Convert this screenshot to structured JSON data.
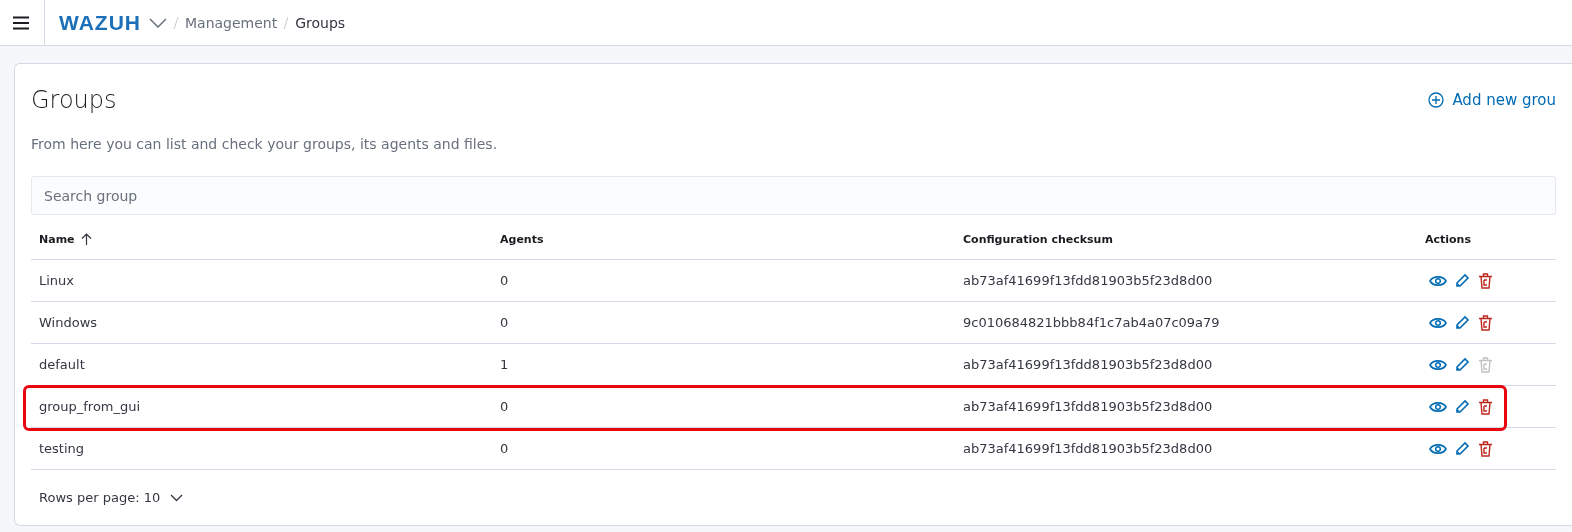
{
  "breadcrumbs": [
    {
      "label": "Management",
      "current": false
    },
    {
      "label": "Groups",
      "current": true
    }
  ],
  "logo": "WAZUH",
  "page": {
    "title": "Groups",
    "description": "From here you can list and check your groups, its agents and files.",
    "add_button": "Add new grou"
  },
  "search": {
    "placeholder": "Search group"
  },
  "table": {
    "columns": [
      {
        "label": "Name",
        "sorted": true
      },
      {
        "label": "Agents",
        "sorted": false
      },
      {
        "label": "Configuration checksum",
        "sorted": false
      },
      {
        "label": "Actions",
        "sorted": false
      }
    ],
    "rows": [
      {
        "name": "Linux",
        "agents": "0",
        "checksum": "ab73af41699f13fdd81903b5f23d8d00",
        "delete_disabled": false,
        "highlighted": false
      },
      {
        "name": "Windows",
        "agents": "0",
        "checksum": "9c010684821bbb84f1c7ab4a07c09a79",
        "delete_disabled": false,
        "highlighted": false
      },
      {
        "name": "default",
        "agents": "1",
        "checksum": "ab73af41699f13fdd81903b5f23d8d00",
        "delete_disabled": true,
        "highlighted": false
      },
      {
        "name": "group_from_gui",
        "agents": "0",
        "checksum": "ab73af41699f13fdd81903b5f23d8d00",
        "delete_disabled": false,
        "highlighted": true
      },
      {
        "name": "testing",
        "agents": "0",
        "checksum": "ab73af41699f13fdd81903b5f23d8d00",
        "delete_disabled": false,
        "highlighted": false
      }
    ]
  },
  "pagination": {
    "rows_per_page": "Rows per page: 10"
  }
}
